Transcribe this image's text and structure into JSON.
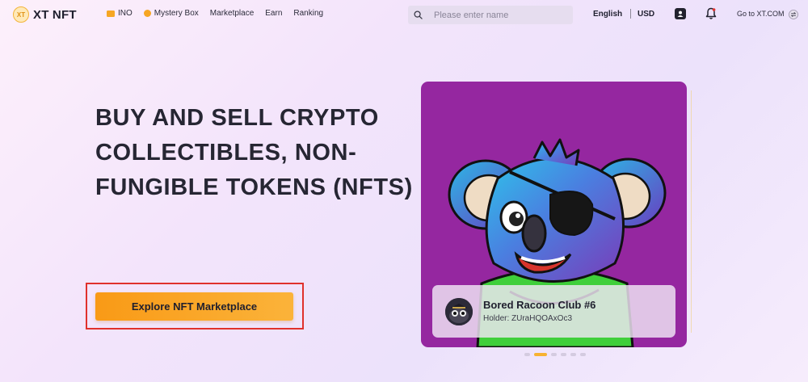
{
  "brand": {
    "logo_mark": "XT",
    "name": "XT NFT"
  },
  "nav": {
    "items": [
      {
        "label": "INO",
        "icon": "ticket-icon"
      },
      {
        "label": "Mystery Box",
        "icon": "coin-icon"
      },
      {
        "label": "Marketplace"
      },
      {
        "label": "Earn"
      },
      {
        "label": "Ranking"
      }
    ]
  },
  "search": {
    "placeholder": "Please enter name",
    "value": ""
  },
  "header_right": {
    "language": "English",
    "currency": "USD",
    "goto_label": "Go to XT.COM"
  },
  "hero": {
    "headline": "BUY AND SELL CRYPTO COLLECTIBLES, NON-FUNGIBLE TOKENS (NFTS)",
    "cta_label": "Explore NFT Marketplace"
  },
  "featured": {
    "title": "Bored Racoon Club #6",
    "holder": "Holder: ZUraHQOAxOc3",
    "card_bg": "#9527a0",
    "carousel": {
      "total": 6,
      "active_index": 1
    }
  },
  "colors": {
    "accent": "#f99a16",
    "highlight_border": "#e0312c",
    "active_dot": "#f7b232"
  }
}
